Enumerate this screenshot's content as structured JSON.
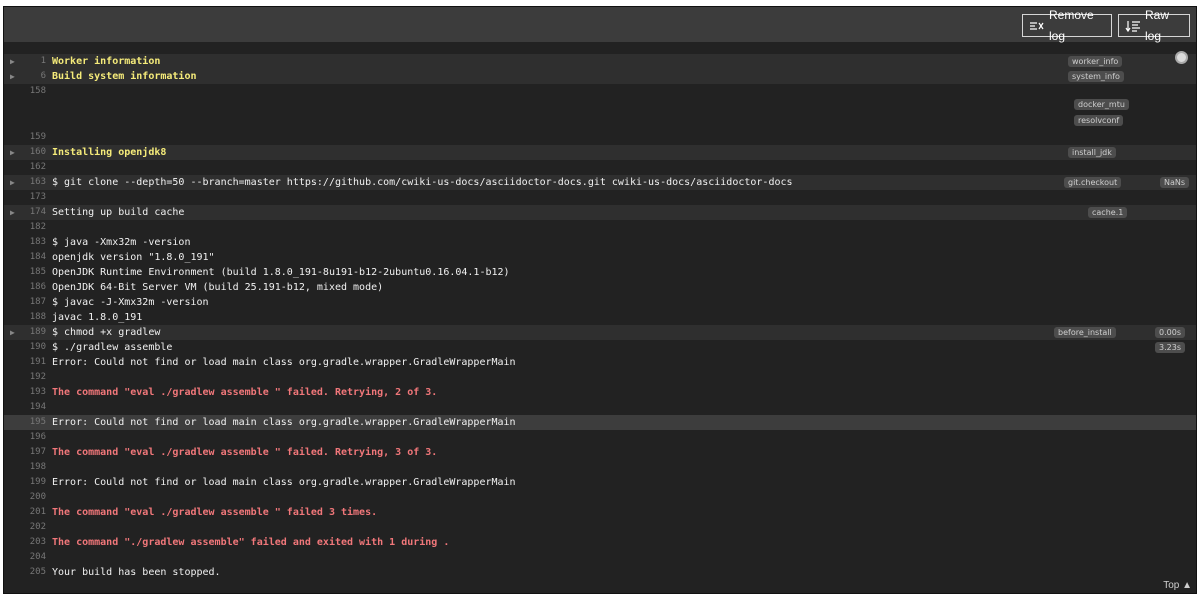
{
  "toolbar": {
    "remove_log_label": "Remove log",
    "raw_log_label": "Raw log"
  },
  "top_link": "Top",
  "colors": {
    "background": "#222222",
    "toolbar": "#3c3c3c",
    "yellow_text": "#f5eb7a",
    "red_text": "#f1777a",
    "line_number": "#777777"
  },
  "tags": {
    "worker_info": "worker_info",
    "system_info": "system_info",
    "docker_mtu": "docker_mtu",
    "resolvconf": "resolvconf",
    "install_jdk": "install_jdk",
    "git_checkout": "git.checkout",
    "nans": "NaNs",
    "cache_1": "cache.1",
    "before_install": "before_install",
    "before_install_time": "0.00s",
    "assemble_time": "3.23s"
  },
  "lines": [
    {
      "num": "1",
      "text": "Worker information"
    },
    {
      "num": "6",
      "text": "Build system information"
    },
    {
      "num": "158",
      "text": ""
    },
    {
      "num": "159",
      "text": ""
    },
    {
      "num": "160",
      "text": "Installing openjdk8"
    },
    {
      "num": "162",
      "text": ""
    },
    {
      "num": "163",
      "text": "$ git clone --depth=50 --branch=master https://github.com/cwiki-us-docs/asciidoctor-docs.git cwiki-us-docs/asciidoctor-docs"
    },
    {
      "num": "173",
      "text": ""
    },
    {
      "num": "174",
      "text": "Setting up build cache"
    },
    {
      "num": "182",
      "text": ""
    },
    {
      "num": "183",
      "text": "$ java -Xmx32m -version"
    },
    {
      "num": "184",
      "text": "openjdk version \"1.8.0_191\""
    },
    {
      "num": "185",
      "text": "OpenJDK Runtime Environment (build 1.8.0_191-8u191-b12-2ubuntu0.16.04.1-b12)"
    },
    {
      "num": "186",
      "text": "OpenJDK 64-Bit Server VM (build 25.191-b12, mixed mode)"
    },
    {
      "num": "187",
      "text": "$ javac -J-Xmx32m -version"
    },
    {
      "num": "188",
      "text": "javac 1.8.0_191"
    },
    {
      "num": "189",
      "text": "$ chmod +x gradlew"
    },
    {
      "num": "190",
      "text": "$ ./gradlew assemble"
    },
    {
      "num": "191",
      "text": "Error: Could not find or load main class org.gradle.wrapper.GradleWrapperMain"
    },
    {
      "num": "192",
      "text": ""
    },
    {
      "num": "193",
      "text": "The command \"eval ./gradlew assemble \" failed. Retrying, 2 of 3."
    },
    {
      "num": "194",
      "text": ""
    },
    {
      "num": "195",
      "text": "Error: Could not find or load main class org.gradle.wrapper.GradleWrapperMain"
    },
    {
      "num": "196",
      "text": ""
    },
    {
      "num": "197",
      "text": "The command \"eval ./gradlew assemble \" failed. Retrying, 3 of 3."
    },
    {
      "num": "198",
      "text": ""
    },
    {
      "num": "199",
      "text": "Error: Could not find or load main class org.gradle.wrapper.GradleWrapperMain"
    },
    {
      "num": "200",
      "text": ""
    },
    {
      "num": "201",
      "text": "The command \"eval ./gradlew assemble \" failed 3 times."
    },
    {
      "num": "202",
      "text": ""
    },
    {
      "num": "203",
      "text": "The command \"./gradlew assemble\" failed and exited with 1 during ."
    },
    {
      "num": "204",
      "text": ""
    },
    {
      "num": "205",
      "text": "Your build has been stopped."
    }
  ]
}
